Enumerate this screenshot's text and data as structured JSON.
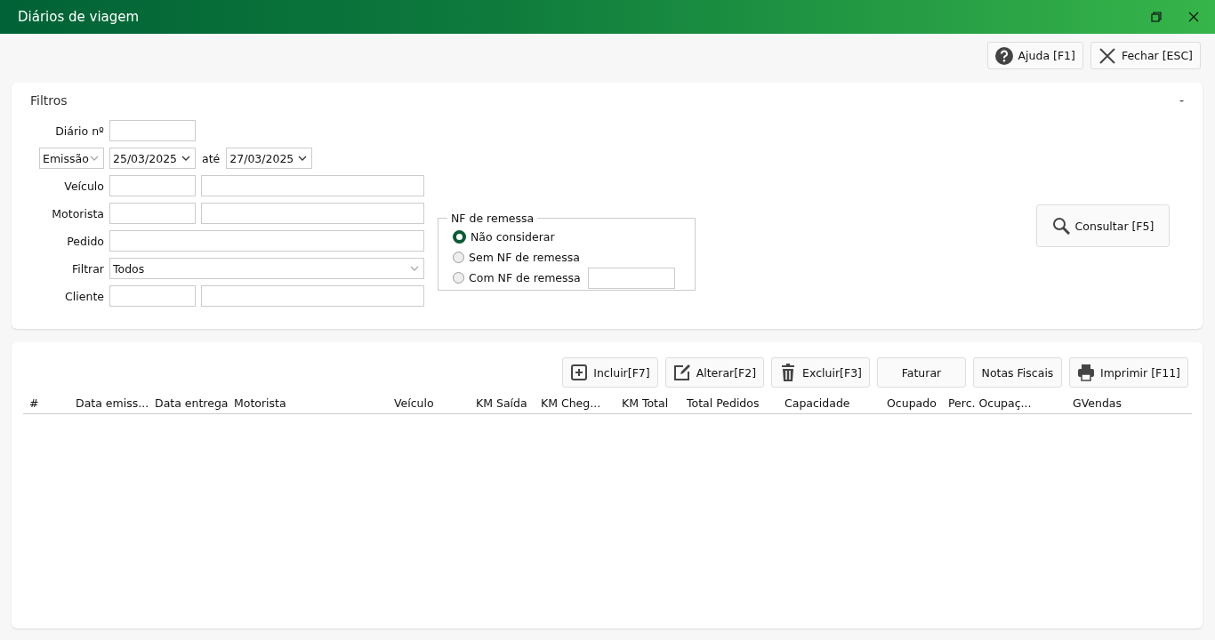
{
  "window": {
    "title": "Diários de viagem"
  },
  "top_buttons": [
    {
      "kind": "help",
      "label": "Ajuda [F1]"
    },
    {
      "kind": "close",
      "label": "Fechar [ESC]"
    }
  ],
  "filters": {
    "title": "Filtros",
    "collapse": "-",
    "rows": [
      {
        "kind": "single",
        "label": "Diário nº"
      },
      {
        "kind": "dates",
        "type_select": "Emissão",
        "from": "25/03/2025",
        "between": "até",
        "to": "27/03/2025"
      },
      {
        "kind": "pair",
        "label": "Veículo"
      },
      {
        "kind": "pair",
        "label": "Motorista"
      },
      {
        "kind": "wide",
        "label": "Pedido"
      },
      {
        "kind": "select",
        "label": "Filtrar",
        "value": "Todos"
      },
      {
        "kind": "pair",
        "label": "Cliente"
      }
    ],
    "nf_remessa": {
      "title": "NF de remessa",
      "options": [
        {
          "kind": "plain",
          "label": "Não considerar",
          "selected": true
        },
        {
          "kind": "plain",
          "label": "Sem NF de remessa",
          "selected": false
        },
        {
          "kind": "with_field",
          "label": "Com NF de remessa",
          "selected": false
        }
      ]
    },
    "search_button": "Consultar [F5]"
  },
  "actions": [
    {
      "kind": "add",
      "label": "Incluir[F7]"
    },
    {
      "kind": "edit",
      "label": "Alterar[F2]"
    },
    {
      "kind": "delete",
      "label": "Excluir[F3]"
    },
    {
      "kind": "text",
      "label": "Faturar"
    },
    {
      "kind": "text",
      "label": "Notas Fiscais"
    },
    {
      "kind": "print",
      "label": "Imprimir [F11]"
    }
  ],
  "table": {
    "columns": [
      "#",
      "Data emiss...",
      "Data entrega",
      "Motorista",
      "Veículo",
      "KM Saída",
      "KM Cheg...",
      "KM Total",
      "Total Pedidos",
      "Capacidade",
      "Ocupado",
      "Perc. Ocupaç...",
      "GVendas"
    ]
  }
}
